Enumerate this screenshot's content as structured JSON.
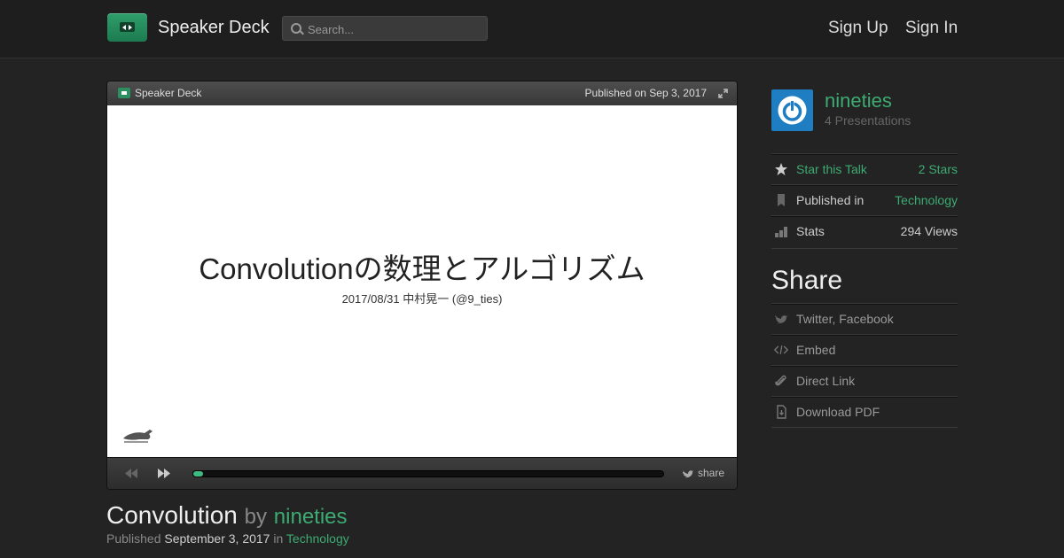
{
  "header": {
    "brand": "Speaker Deck",
    "search_placeholder": "Search...",
    "sign_up": "Sign Up",
    "sign_in": "Sign In",
    "accent_color": "#2e9e6b"
  },
  "player": {
    "brand": "Speaker Deck",
    "published": "Published on Sep 3, 2017",
    "slide_title": "Convolutionの数理とアルゴリズム",
    "slide_subtitle": "2017/08/31 中村晃一 (@9_ties)",
    "progress_fraction": 0.02,
    "share_label": "share"
  },
  "talk": {
    "title": "Convolution",
    "by": "by",
    "author": "nineties",
    "published_label": "Published",
    "date": "September 3, 2017",
    "in_label": "in",
    "category": "Technology"
  },
  "sidebar": {
    "user_name": "nineties",
    "presentations": "4 Presentations",
    "star_label": "Star this Talk",
    "stars": "2 Stars",
    "published_in_label": "Published in",
    "published_in_value": "Technology",
    "stats_label": "Stats",
    "views": "294 Views",
    "share_heading": "Share",
    "share_items": {
      "social": "Twitter, Facebook",
      "embed": "Embed",
      "direct": "Direct Link",
      "pdf": "Download PDF"
    }
  }
}
